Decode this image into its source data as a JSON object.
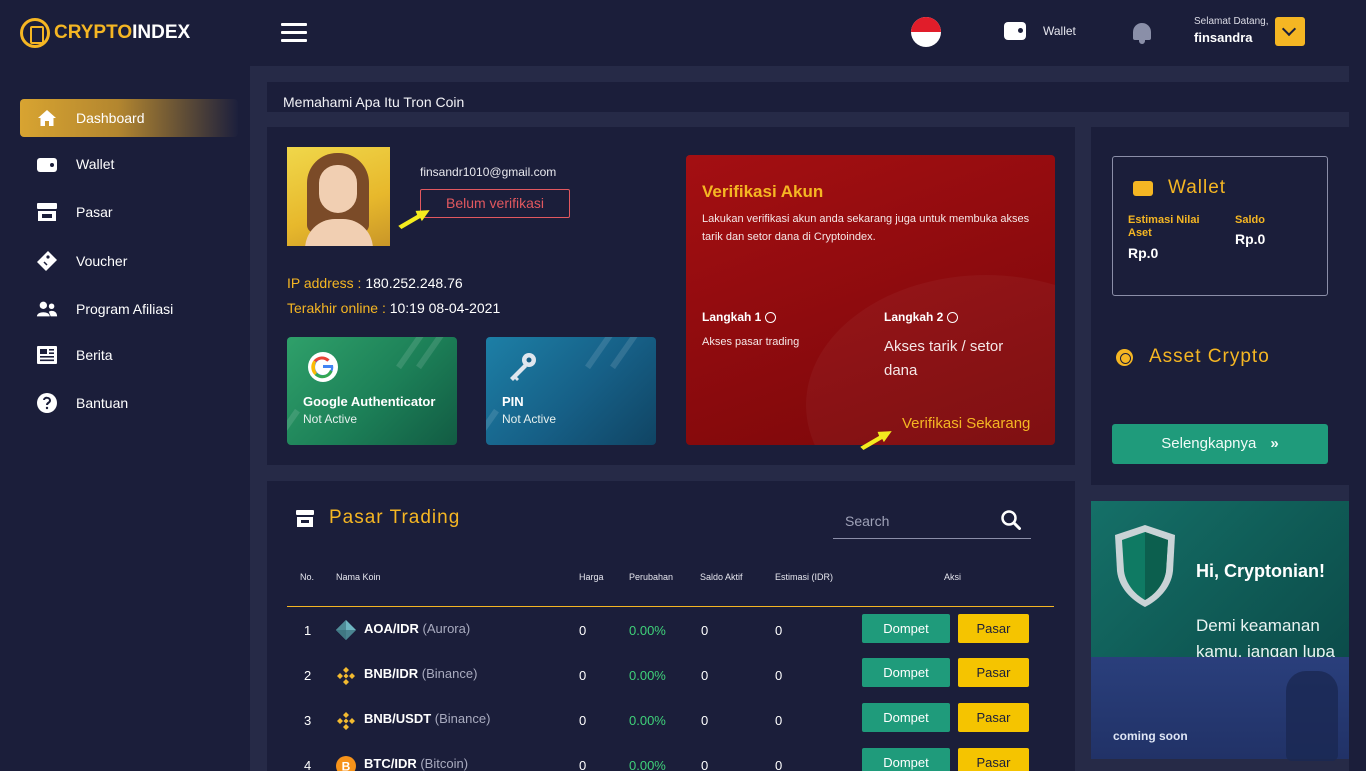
{
  "brand": {
    "name_prefix": "CRYPTO",
    "name_suffix": "INDEX"
  },
  "header": {
    "wallet_label": "Wallet",
    "greeting": "Selamat Datang,",
    "username": "finsandra"
  },
  "sidebar": {
    "items": [
      {
        "label": "Dashboard",
        "icon": "home-icon"
      },
      {
        "label": "Wallet",
        "icon": "wallet-icon"
      },
      {
        "label": "Pasar",
        "icon": "store-icon"
      },
      {
        "label": "Voucher",
        "icon": "ticket-icon"
      },
      {
        "label": "Program Afiliasi",
        "icon": "users-icon"
      },
      {
        "label": "Berita",
        "icon": "news-icon"
      },
      {
        "label": "Bantuan",
        "icon": "help-icon"
      }
    ]
  },
  "announcement": "Memahami Apa Itu Tron Coin",
  "profile": {
    "email": "finsandr1010@gmail.com",
    "verification_status": "Belum verifikasi",
    "ip_label": "IP address : ",
    "ip_value": "180.252.248.76",
    "last_online_label": "Terakhir online : ",
    "last_online_value": "10:19 08-04-2021"
  },
  "security": [
    {
      "title": "Google Authenticator",
      "status": "Not Active"
    },
    {
      "title": "PIN",
      "status": "Not Active"
    }
  ],
  "verification": {
    "title": "Verifikasi Akun",
    "description": "Lakukan verifikasi akun anda sekarang juga untuk membuka akses tarik dan setor dana di Cryptoindex.",
    "step1_title": "Langkah 1",
    "step1_desc": "Akses pasar trading",
    "step2_title": "Langkah 2",
    "step2_desc": "Akses tarik / setor dana",
    "cta": "Verifikasi Sekarang"
  },
  "wallet_card": {
    "title": "Wallet",
    "estimate_label_1": "Estimasi Nilai",
    "estimate_label_2": "Aset",
    "estimate_value": "Rp.0",
    "saldo_label": "Saldo",
    "saldo_value": "Rp.0",
    "asset_title": "Asset Crypto",
    "more_button": "Selengkapnya"
  },
  "trading": {
    "title": "Pasar Trading",
    "search_placeholder": "Search",
    "columns": [
      "No.",
      "Nama Koin",
      "Harga",
      "Perubahan",
      "Saldo Aktif",
      "Estimasi (IDR)",
      "Aksi"
    ],
    "rows": [
      {
        "no": "1",
        "pair": "AOA/IDR",
        "name": "(Aurora)",
        "price": "0",
        "change": "0.00%",
        "balance": "0",
        "estimate": "0",
        "icon": "aurora-icon"
      },
      {
        "no": "2",
        "pair": "BNB/IDR",
        "name": "(Binance)",
        "price": "0",
        "change": "0.00%",
        "balance": "0",
        "estimate": "0",
        "icon": "binance-icon"
      },
      {
        "no": "3",
        "pair": "BNB/USDT",
        "name": "(Binance)",
        "price": "0",
        "change": "0.00%",
        "balance": "0",
        "estimate": "0",
        "icon": "binance-icon"
      },
      {
        "no": "4",
        "pair": "BTC/IDR",
        "name": "(Bitcoin)",
        "price": "0",
        "change": "0.00%",
        "balance": "0",
        "estimate": "0",
        "icon": "bitcoin-icon"
      }
    ],
    "dompet_label": "Dompet",
    "pasar_label": "Pasar"
  },
  "banner": {
    "headline": "Hi, Cryptonian!",
    "subtext": "Demi keamanan kamu, jangan lupa",
    "footer": "coming soon"
  },
  "colors": {
    "accent": "#f5b623",
    "sidebar_bg": "#1b1e3a",
    "content_bg": "#262a47",
    "green_button": "#1f9b7b",
    "yellow_button": "#f5c400",
    "verify_red": "#a40f12",
    "positive_change": "#3fd17a"
  }
}
